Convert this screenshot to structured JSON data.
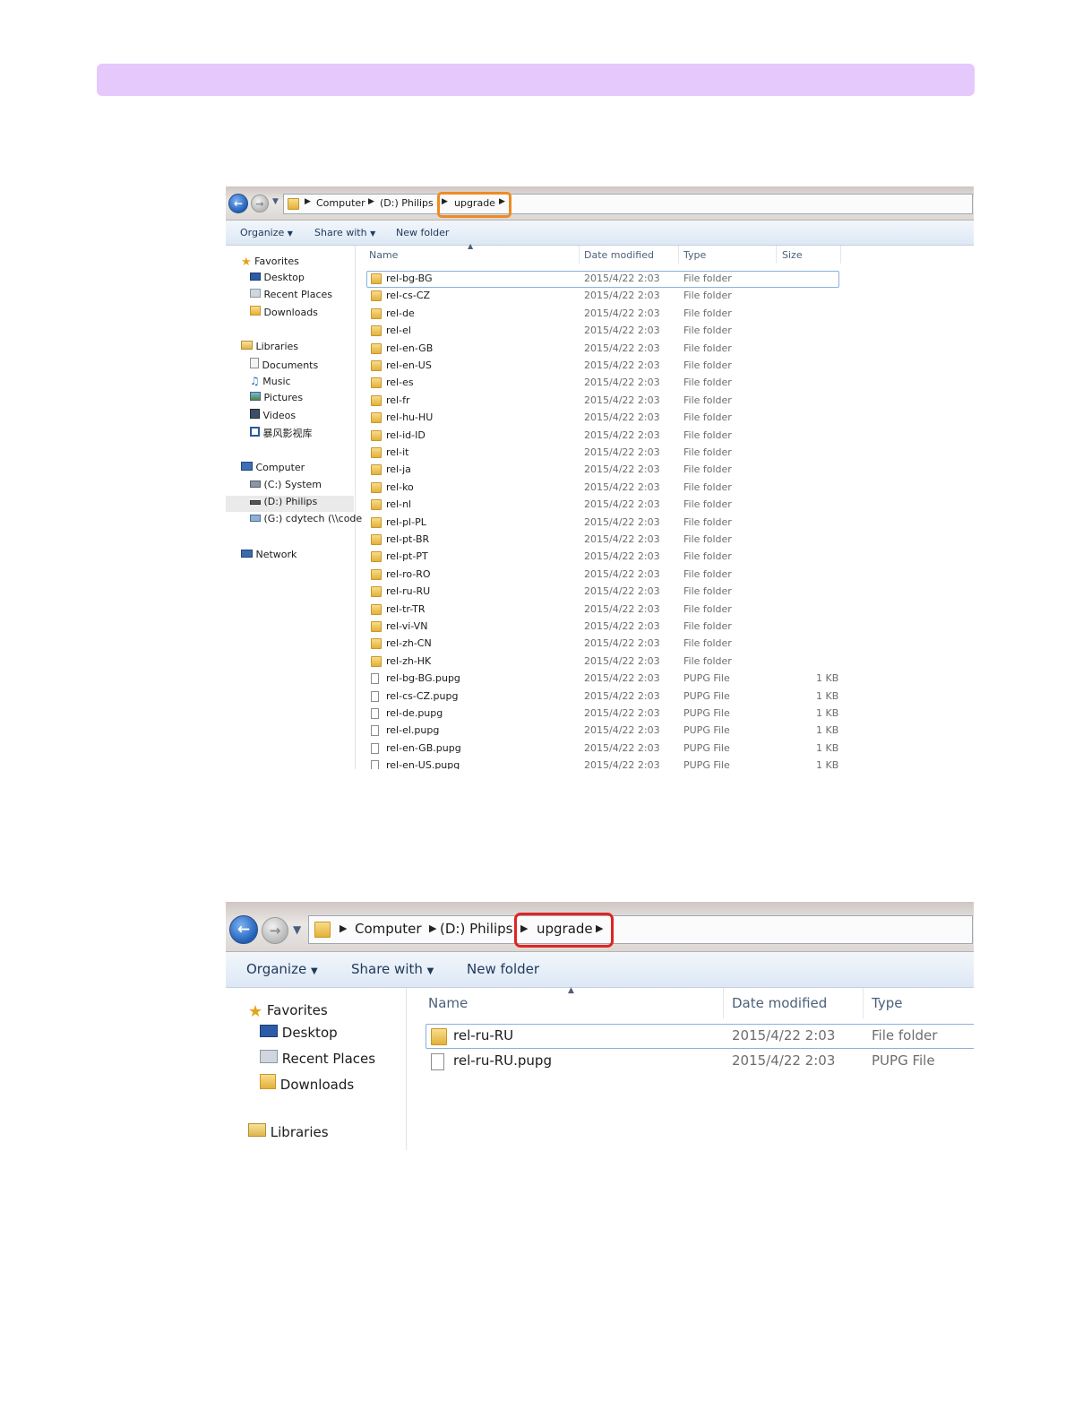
{
  "banner": {
    "color": "#e5c8fc"
  },
  "explorer_full": {
    "breadcrumb": [
      "Computer",
      "(D:) Philips",
      "upgrade"
    ],
    "highlight_color": "#f08a24",
    "toolbar": {
      "organize": "Organize",
      "share_with": "Share with",
      "new_folder": "New folder"
    },
    "nav": {
      "favorites": "Favorites",
      "desktop": "Desktop",
      "recent_places": "Recent Places",
      "downloads": "Downloads",
      "libraries": "Libraries",
      "documents": "Documents",
      "music": "Music",
      "pictures": "Pictures",
      "videos": "Videos",
      "video_library": "暴风影视库",
      "computer": "Computer",
      "drive_c": "(C:) System",
      "drive_d": "(D:) Philips",
      "drive_g": "(G:) cdytech (\\\\code",
      "network": "Network"
    },
    "columns": {
      "name": "Name",
      "date": "Date modified",
      "type": "Type",
      "size": "Size"
    },
    "rows": [
      {
        "name": "rel-bg-BG",
        "date": "2015/4/22 2:03",
        "type": "File folder",
        "size": ""
      },
      {
        "name": "rel-cs-CZ",
        "date": "2015/4/22 2:03",
        "type": "File folder",
        "size": ""
      },
      {
        "name": "rel-de",
        "date": "2015/4/22 2:03",
        "type": "File folder",
        "size": ""
      },
      {
        "name": "rel-el",
        "date": "2015/4/22 2:03",
        "type": "File folder",
        "size": ""
      },
      {
        "name": "rel-en-GB",
        "date": "2015/4/22 2:03",
        "type": "File folder",
        "size": ""
      },
      {
        "name": "rel-en-US",
        "date": "2015/4/22 2:03",
        "type": "File folder",
        "size": ""
      },
      {
        "name": "rel-es",
        "date": "2015/4/22 2:03",
        "type": "File folder",
        "size": ""
      },
      {
        "name": "rel-fr",
        "date": "2015/4/22 2:03",
        "type": "File folder",
        "size": ""
      },
      {
        "name": "rel-hu-HU",
        "date": "2015/4/22 2:03",
        "type": "File folder",
        "size": ""
      },
      {
        "name": "rel-id-ID",
        "date": "2015/4/22 2:03",
        "type": "File folder",
        "size": ""
      },
      {
        "name": "rel-it",
        "date": "2015/4/22 2:03",
        "type": "File folder",
        "size": ""
      },
      {
        "name": "rel-ja",
        "date": "2015/4/22 2:03",
        "type": "File folder",
        "size": ""
      },
      {
        "name": "rel-ko",
        "date": "2015/4/22 2:03",
        "type": "File folder",
        "size": ""
      },
      {
        "name": "rel-nl",
        "date": "2015/4/22 2:03",
        "type": "File folder",
        "size": ""
      },
      {
        "name": "rel-pl-PL",
        "date": "2015/4/22 2:03",
        "type": "File folder",
        "size": ""
      },
      {
        "name": "rel-pt-BR",
        "date": "2015/4/22 2:03",
        "type": "File folder",
        "size": ""
      },
      {
        "name": "rel-pt-PT",
        "date": "2015/4/22 2:03",
        "type": "File folder",
        "size": ""
      },
      {
        "name": "rel-ro-RO",
        "date": "2015/4/22 2:03",
        "type": "File folder",
        "size": ""
      },
      {
        "name": "rel-ru-RU",
        "date": "2015/4/22 2:03",
        "type": "File folder",
        "size": ""
      },
      {
        "name": "rel-tr-TR",
        "date": "2015/4/22 2:03",
        "type": "File folder",
        "size": ""
      },
      {
        "name": "rel-vi-VN",
        "date": "2015/4/22 2:03",
        "type": "File folder",
        "size": ""
      },
      {
        "name": "rel-zh-CN",
        "date": "2015/4/22 2:03",
        "type": "File folder",
        "size": ""
      },
      {
        "name": "rel-zh-HK",
        "date": "2015/4/22 2:03",
        "type": "File folder",
        "size": ""
      },
      {
        "name": "rel-bg-BG.pupg",
        "date": "2015/4/22 2:03",
        "type": "PUPG File",
        "size": "1 KB"
      },
      {
        "name": "rel-cs-CZ.pupg",
        "date": "2015/4/22 2:03",
        "type": "PUPG File",
        "size": "1 KB"
      },
      {
        "name": "rel-de.pupg",
        "date": "2015/4/22 2:03",
        "type": "PUPG File",
        "size": "1 KB"
      },
      {
        "name": "rel-el.pupg",
        "date": "2015/4/22 2:03",
        "type": "PUPG File",
        "size": "1 KB"
      },
      {
        "name": "rel-en-GB.pupg",
        "date": "2015/4/22 2:03",
        "type": "PUPG File",
        "size": "1 KB"
      },
      {
        "name": "rel-en-US.pupg",
        "date": "2015/4/22 2:03",
        "type": "PUPG File",
        "size": "1 KB"
      }
    ]
  },
  "explorer_filtered": {
    "breadcrumb": [
      "Computer",
      "(D:) Philips",
      "upgrade"
    ],
    "highlight_color": "#e02424",
    "toolbar": {
      "organize": "Organize",
      "share_with": "Share with",
      "new_folder": "New folder"
    },
    "nav": {
      "favorites": "Favorites",
      "desktop": "Desktop",
      "recent_places": "Recent Places",
      "downloads": "Downloads",
      "libraries": "Libraries"
    },
    "columns": {
      "name": "Name",
      "date": "Date modified",
      "type": "Type"
    },
    "rows": [
      {
        "name": "rel-ru-RU",
        "date": "2015/4/22 2:03",
        "type": "File folder"
      },
      {
        "name": "rel-ru-RU.pupg",
        "date": "2015/4/22 2:03",
        "type": "PUPG File"
      }
    ]
  }
}
